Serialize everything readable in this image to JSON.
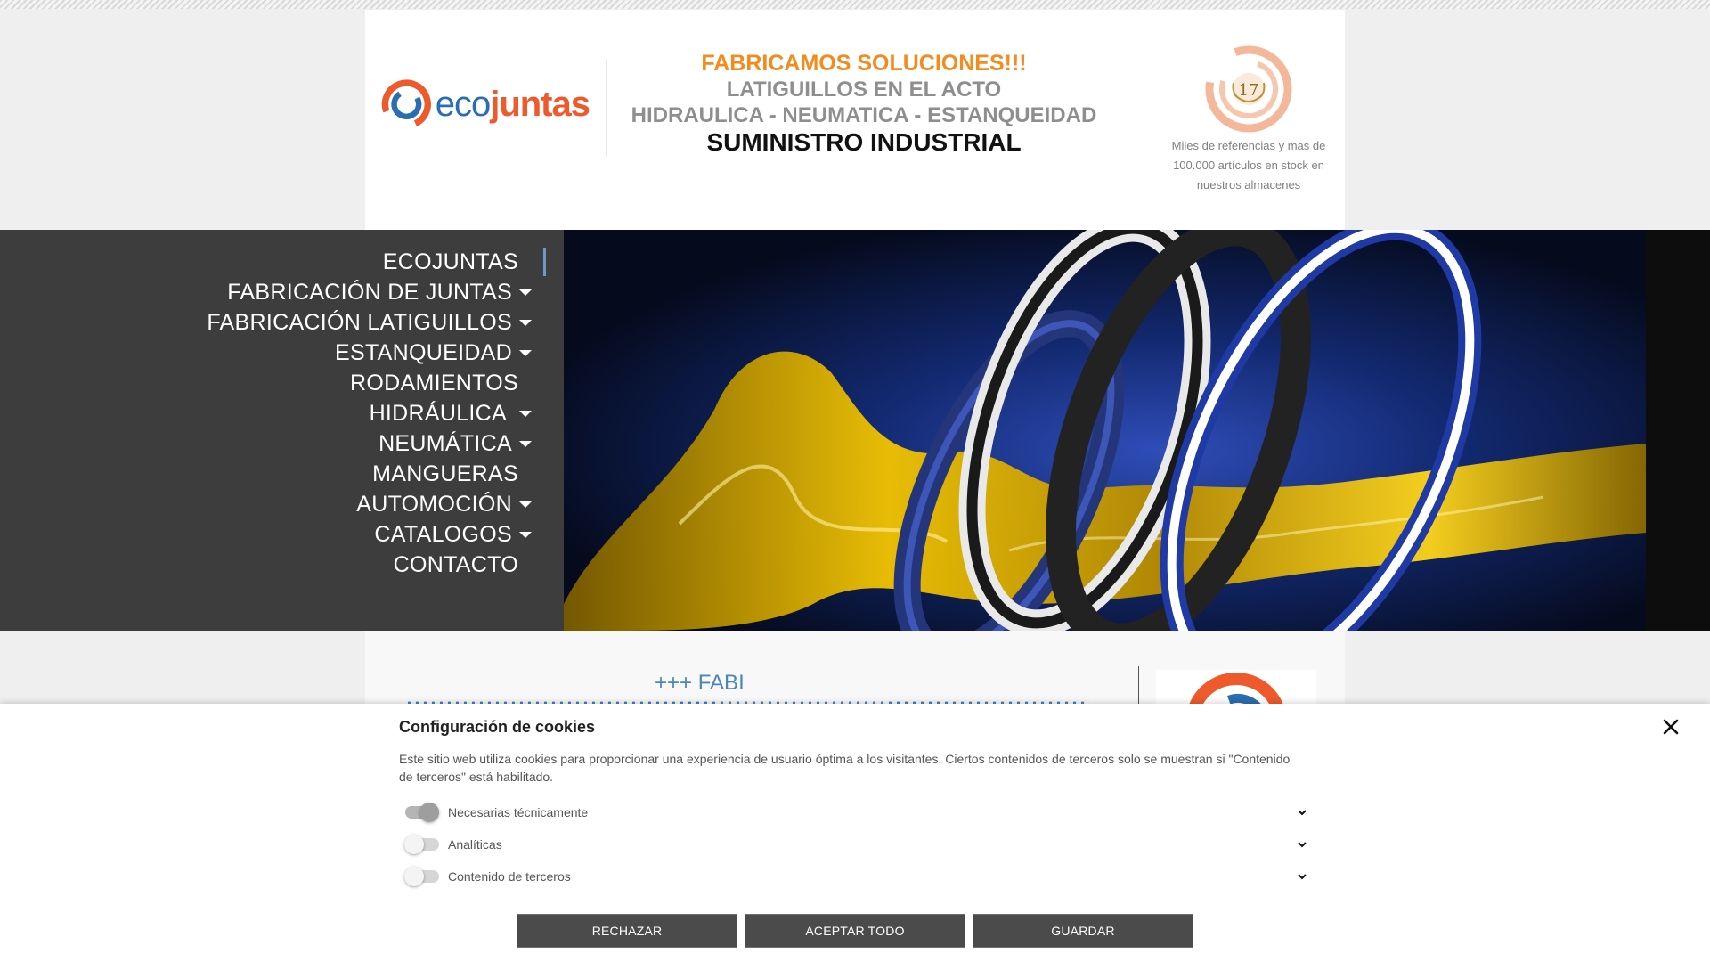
{
  "header": {
    "logo": {
      "text_eco": "eco",
      "text_juntas": "juntas"
    },
    "tagline": {
      "line1": "FABRICAMOS SOLUCIONES!!!",
      "line2": "LATIGUILLOS EN EL ACTO",
      "line3": "HIDRAULICA - NEUMATICA - ESTANQUEIDAD",
      "line4": "SUMINISTRO INDUSTRIAL"
    },
    "badge_number": "17",
    "stock_note": "Miles de referencias y mas de 100.000 artículos en stock en nuestros almacenes"
  },
  "nav": {
    "items": [
      {
        "label": "ECOJUNTAS",
        "has_dropdown": false,
        "active": true
      },
      {
        "label": "FABRICACIÓN DE JUNTAS",
        "has_dropdown": true
      },
      {
        "label": "FABRICACIÓN LATIGUILLOS",
        "has_dropdown": true
      },
      {
        "label": "ESTANQUEIDAD",
        "has_dropdown": true
      },
      {
        "label": "RODAMIENTOS",
        "has_dropdown": false
      },
      {
        "label": "HIDRÁULICA",
        "has_dropdown": true
      },
      {
        "label": "NEUMÁTICA",
        "has_dropdown": true
      },
      {
        "label": "MANGUERAS",
        "has_dropdown": false
      },
      {
        "label": "AUTOMOCIÓN",
        "has_dropdown": true
      },
      {
        "label": "CATALOGOS",
        "has_dropdown": true
      },
      {
        "label": "CONTACTO",
        "has_dropdown": false
      }
    ]
  },
  "content": {
    "marquee": "+++  FABI"
  },
  "cookie": {
    "title": "Configuración de cookies",
    "description": "Este sitio web utiliza cookies para proporcionar una experiencia de usuario óptima a los visitantes. Ciertos contenidos de terceros solo se muestran si \"Contenido de terceros\" está habilitado.",
    "options": [
      {
        "label": "Necesarias técnicamente",
        "enabled": true
      },
      {
        "label": "Analíticas",
        "enabled": false
      },
      {
        "label": "Contenido de terceros",
        "enabled": false
      }
    ],
    "buttons": {
      "reject": "RECHAZAR",
      "accept_all": "ACEPTAR TODO",
      "save": "GUARDAR"
    }
  },
  "colors": {
    "brand_orange": "#ee5a2c",
    "brand_blue": "#2a6db2",
    "tagline_orange": "#f38b1f",
    "nav_background": "#3d3d3d",
    "button_background": "#4b4b4b"
  },
  "icons": {
    "nav_dropdown": "caret-down-icon",
    "cookie_close": "close-icon",
    "cookie_expand": "chevron-down-icon"
  }
}
